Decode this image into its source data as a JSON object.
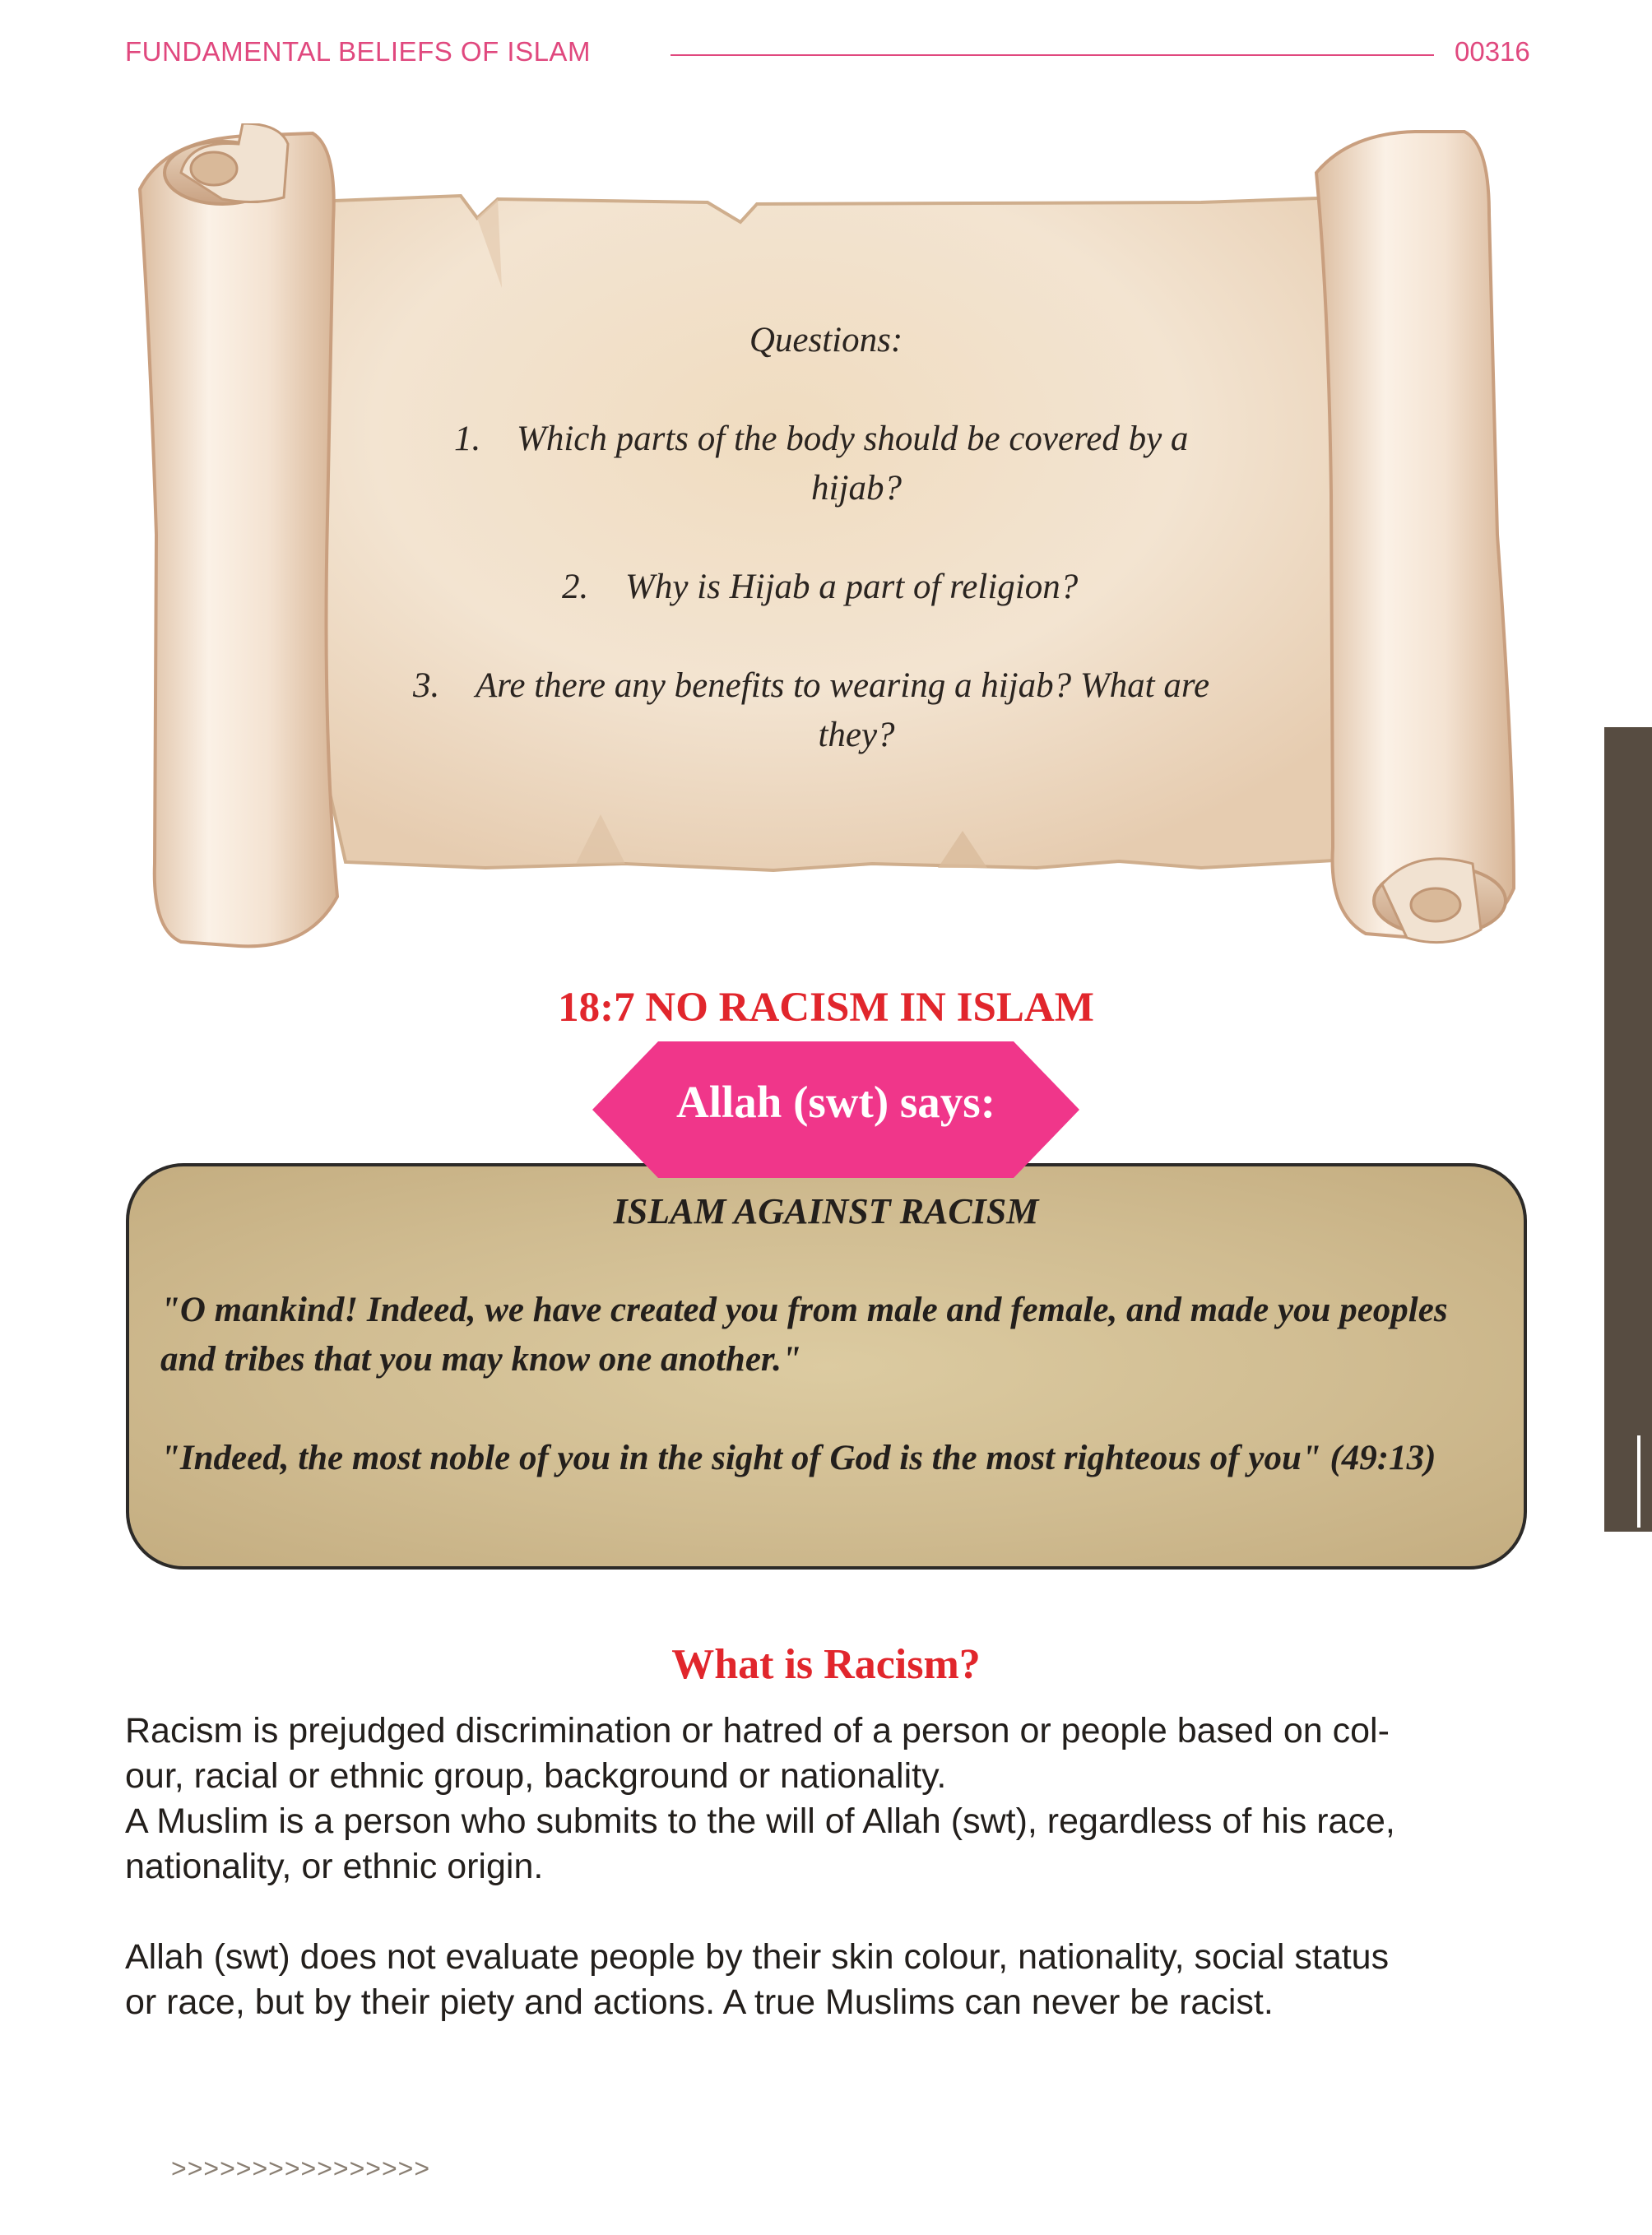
{
  "header": {
    "title": "FUNDAMENTAL BELIEFS  OF ISLAM",
    "page_number": "00316"
  },
  "scroll": {
    "title": "Questions:",
    "questions": [
      {
        "num": "1.",
        "line1": "Which parts of the body should be covered by a",
        "line2": "hijab?"
      },
      {
        "num": "2.",
        "line1": "Why is Hijab a part of religion?",
        "line2": ""
      },
      {
        "num": "3.",
        "line1": "Are there any benefits to wearing a hijab? What are",
        "line2": "they?"
      }
    ]
  },
  "section": {
    "heading": "18:7  NO RACISM IN ISLAM"
  },
  "badge": {
    "label": "Allah (swt) says:"
  },
  "quote": {
    "title": "ISLAM AGAINST RACISM",
    "line1": "\"O mankind! Indeed, we have created you from male and female, and made you peoples",
    "line2": "and tribes that you may know one another.\"",
    "line3": "\"Indeed, the most noble of  you in the sight of God is the most righteous of  you\" (49:13)"
  },
  "body": {
    "heading": "What is Racism?",
    "p1_line1": "Racism is prejudged discrimination or hatred of a person or people based on col-",
    "p1_line2": "our, racial or ethnic group, background or nationality.",
    "p2_line1": "A Muslim is a person who submits to the will of Allah (swt), regardless of his race,",
    "p2_line2": "nationality, or ethnic origin.",
    "p3_line1": "Allah (swt) does not evaluate people by their skin colour, nationality, social status",
    "p3_line2": "or race, but by their piety and actions. A true Muslims can never be racist."
  },
  "footer": {
    "arrows": ">>>>>>>>>>>>>>>>"
  },
  "colors": {
    "accent_pink": "#e0487e",
    "badge_pink": "#f0368a",
    "heading_red": "#e1262c",
    "side_tab": "#574c41",
    "quote_bg": "#d5c296",
    "parchment": "#f2e1cc"
  }
}
